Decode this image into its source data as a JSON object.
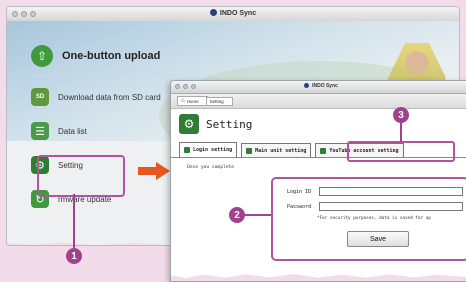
{
  "app_window": {
    "title": "INDO Sync",
    "menu": [
      {
        "label": "One-button upload",
        "icon": "upload-icon"
      },
      {
        "label": "Download data from SD card",
        "icon": "sd-card-icon",
        "icon_text": "SD"
      },
      {
        "label": "Data list",
        "icon": "list-icon"
      },
      {
        "label": "Setting",
        "icon": "gear-icon"
      },
      {
        "label": "rmware update",
        "icon": "refresh-icon"
      }
    ]
  },
  "settings_window": {
    "title": "INDO Sync",
    "breadcrumb": {
      "home": "Home",
      "current": "Setting"
    },
    "heading": "Setting",
    "tabs": [
      "Login setting",
      "Main unit setting",
      "YouTube account setting"
    ],
    "note": "Once you complete",
    "form": {
      "login_label": "Login ID",
      "password_label": "Password",
      "login_value": "",
      "password_value": "",
      "security_note": "*For security purposes, data is saved for up",
      "save_label": "Save"
    }
  },
  "markers": [
    "1",
    "2",
    "3"
  ],
  "colors": {
    "highlight": "#b0559b",
    "marker": "#a1428f",
    "arrow": "#e8561f",
    "icon_green": "#3f9a3f"
  }
}
